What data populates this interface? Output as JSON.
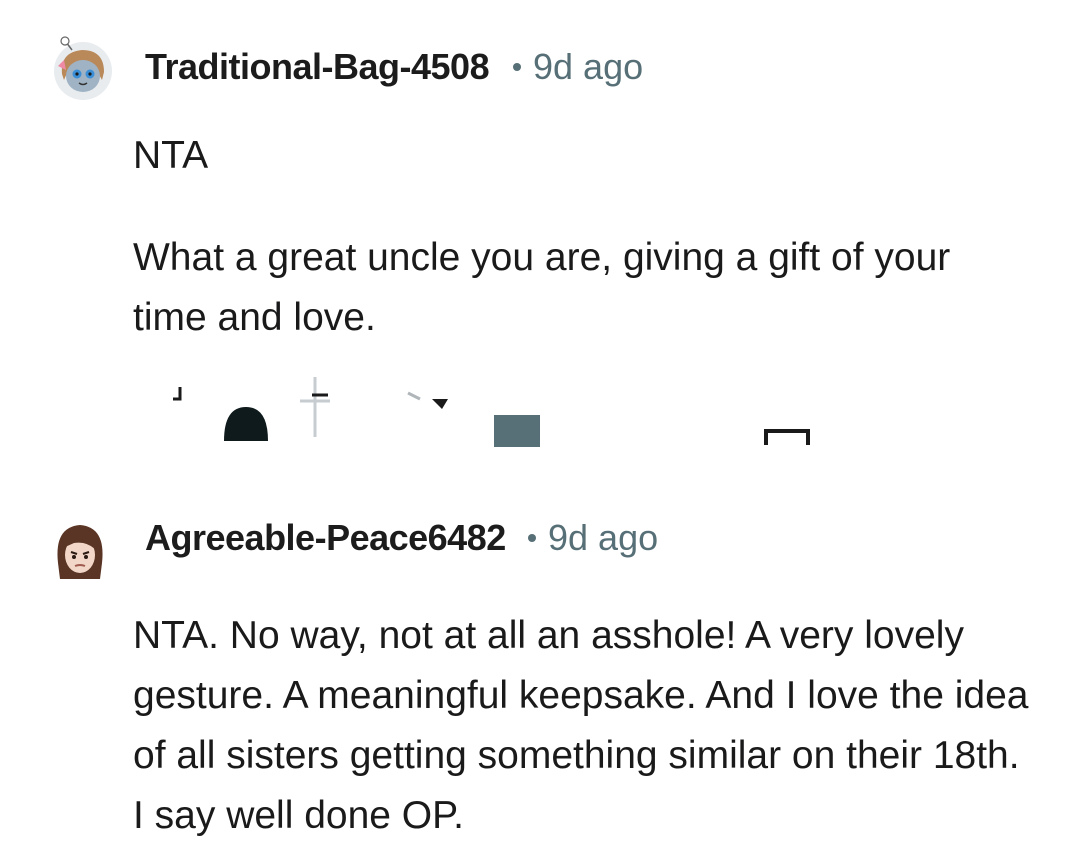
{
  "comments": [
    {
      "username": "Traditional-Bag-4508",
      "time": "9d ago",
      "paragraphs": [
        "NTA",
        "What a great uncle you are, giving a gift of your time and love."
      ],
      "action_icons": [
        "upvote-icon",
        "award-icon",
        "share-icon",
        "reply-icon",
        "more-icon"
      ]
    },
    {
      "username": "Agreeable-Peace6482",
      "time": "9d ago",
      "paragraphs": [
        "NTA. No way, not at all an asshole! A very lovely gesture. A meaningful keepsake. And I love the idea of all sisters getting something similar on their 18th. I say well done OP."
      ]
    }
  ],
  "colors": {
    "text": "#1a1a1b",
    "meta": "#576f76",
    "background": "#ffffff"
  }
}
